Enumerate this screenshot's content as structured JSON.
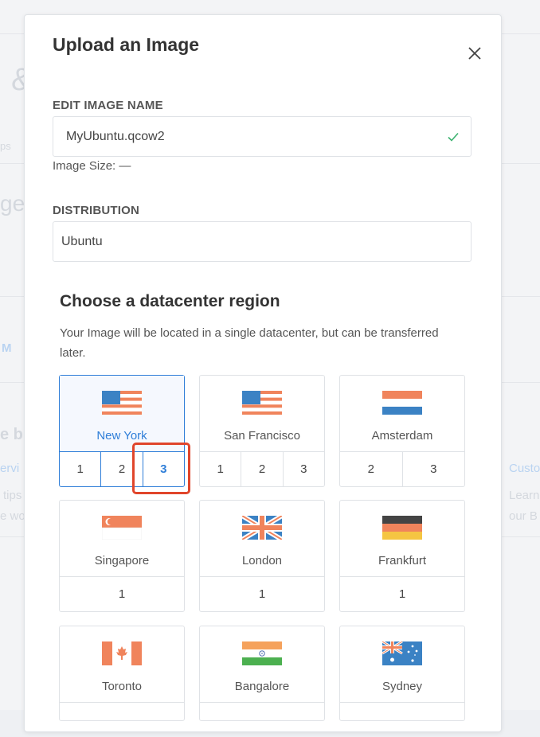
{
  "modal": {
    "title": "Upload an Image",
    "close_icon": "close-icon"
  },
  "form": {
    "name_label": "EDIT IMAGE NAME",
    "name_value": "MyUbuntu.qcow2",
    "name_valid_icon": "checkmark-icon",
    "image_size_text": "Image Size: —",
    "distribution_label": "DISTRIBUTION",
    "distribution_value": "Ubuntu"
  },
  "region_section": {
    "title": "Choose a datacenter region",
    "description": "Your Image will be located in a single datacenter, but can be transferred later."
  },
  "regions": [
    {
      "name": "New York",
      "flag": "us-flag-icon",
      "numbers": [
        "1",
        "2",
        "3"
      ],
      "selected": true,
      "active_number": "3"
    },
    {
      "name": "San Francisco",
      "flag": "us-flag-icon",
      "numbers": [
        "1",
        "2",
        "3"
      ]
    },
    {
      "name": "Amsterdam",
      "flag": "netherlands-flag-icon",
      "numbers": [
        "2",
        "3"
      ]
    },
    {
      "name": "Singapore",
      "flag": "singapore-flag-icon",
      "numbers": [
        "1"
      ]
    },
    {
      "name": "London",
      "flag": "uk-flag-icon",
      "numbers": [
        "1"
      ]
    },
    {
      "name": "Frankfurt",
      "flag": "germany-flag-icon",
      "numbers": [
        "1"
      ]
    },
    {
      "name": "Toronto",
      "flag": "canada-flag-icon",
      "numbers": []
    },
    {
      "name": "Bangalore",
      "flag": "india-flag-icon",
      "numbers": []
    },
    {
      "name": "Sydney",
      "flag": "australia-flag-icon",
      "numbers": []
    }
  ],
  "background": {
    "fragments": [
      "&",
      "ps",
      "ge",
      "M",
      "e b",
      "ervi",
      "tips",
      "e wo",
      "Custo",
      "Learn",
      "our B"
    ]
  },
  "colors": {
    "accent": "#2f7ed8",
    "highlight": "#e0452b",
    "valid": "#3bb26f"
  }
}
